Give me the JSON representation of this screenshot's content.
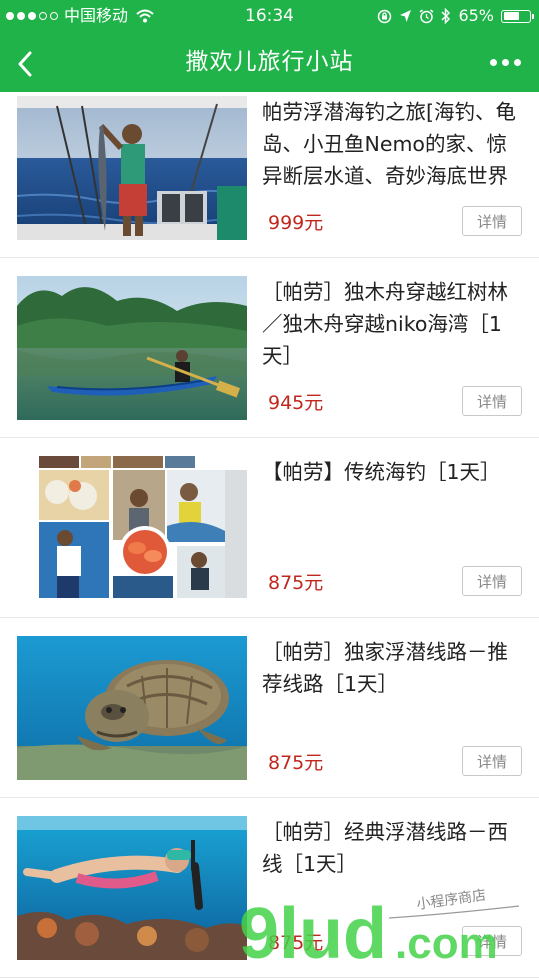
{
  "status_bar": {
    "carrier": "中国移动",
    "time": "16:34",
    "battery": "65%",
    "battery_level": 0.65
  },
  "nav": {
    "title": "撒欢儿旅行小站"
  },
  "items": [
    {
      "title": "帕劳浮潜海钓之旅[海钓、龟岛、小丑鱼Nemo的家、惊异断层水道、奇妙海底世界",
      "price": "999元",
      "detail_label": "详情"
    },
    {
      "title": "［帕劳］独木舟穿越红树林／独木舟穿越niko海湾［1天］",
      "price": "945元",
      "detail_label": "详情"
    },
    {
      "title": "【帕劳】传统海钓［1天］",
      "price": "875元",
      "detail_label": "详情"
    },
    {
      "title": "［帕劳］独家浮潜线路－推荐线路［1天］",
      "price": "875元",
      "detail_label": "详情"
    },
    {
      "title": "［帕劳］经典浮潜线路－西线［1天］",
      "price": "875元",
      "detail_label": "详情"
    }
  ],
  "watermark": {
    "brand": "9lud.com",
    "tagline": "小程序商店"
  },
  "colors": {
    "accent": "#1fb349",
    "price": "#c0281e"
  }
}
